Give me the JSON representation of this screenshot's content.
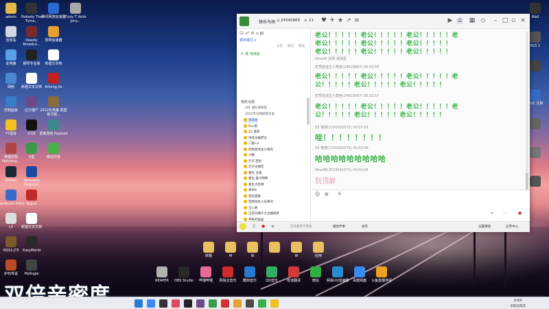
{
  "desktop": {
    "icons_left": [
      {
        "label": "admin",
        "color": "#e6b84a"
      },
      {
        "label": "回收站",
        "color": "#cfd8e3"
      },
      {
        "label": "此电脑",
        "color": "#5aa0e6"
      },
      {
        "label": "网络",
        "color": "#4a86d0"
      },
      {
        "label": "控制面板",
        "color": "#3a7cc9"
      },
      {
        "label": "YY语音",
        "color": "#f3c024"
      },
      {
        "label": "修魂苏明 Mahjong...",
        "color": "#b34444"
      },
      {
        "label": "Steam",
        "color": "#1b2838"
      },
      {
        "label": "Bandicam 64bit",
        "color": "#3b6bc9"
      },
      {
        "label": "LX",
        "color": "#dddddd"
      },
      {
        "label": "ISSS1.JTS",
        "color": "#7a5a2a"
      },
      {
        "label": "炉石传说",
        "color": "#b84d2a"
      }
    ],
    "icons_col2": [
      {
        "label": "Nobody The Turna...",
        "color": "#333333"
      },
      {
        "label": "Deadly Broadca...",
        "color": "#7a2a2a"
      },
      {
        "label": "钢琴专业版",
        "color": "#222222"
      },
      {
        "label": "新建文本文档",
        "color": "#ffffff"
      },
      {
        "label": "亿万僵尸",
        "color": "#6a4a8a"
      },
      {
        "label": "iCUE",
        "color": "#111111"
      },
      {
        "label": "X蓝",
        "color": "#3a9a4a"
      },
      {
        "label": "Samsung Magician",
        "color": "#1a4aa0"
      },
      {
        "label": "Rogue",
        "color": "#c02a2a"
      },
      {
        "label": "新建文本文档",
        "color": "#ffffff"
      },
      {
        "label": "EasyWorld",
        "color": "#2a2a2a"
      },
      {
        "label": "MyKugle",
        "color": "#444444"
      }
    ],
    "icons_col3": [
      {
        "label": "腾讯网游加速器",
        "color": "#2a6ad0"
      },
      {
        "label": "雷神加速器",
        "color": "#e8a030"
      },
      {
        "label": "新建文本档",
        "color": "#ffffff"
      },
      {
        "label": "Among Us",
        "color": "#c02020"
      },
      {
        "label": "2022年英雄 联盟 官方服...",
        "color": "#8a6a3a"
      },
      {
        "label": "雷索游戏 Payload",
        "color": "#3a8a8a"
      },
      {
        "label": "微信托管",
        "color": "#4ab04a"
      }
    ],
    "icons_col4": [
      {
        "label": "Tizzy T VaVa Jony...",
        "color": "#aaaaaa"
      }
    ],
    "icons_right": [
      {
        "label": "Wall",
        "color": "#333333"
      },
      {
        "label": "RLS 1",
        "color": "#555555"
      },
      {
        "label": "",
        "color": "#444444"
      },
      {
        "label": "DOC 文档",
        "color": "#3a6ac9"
      },
      {
        "label": "",
        "color": "#666666"
      },
      {
        "label": "",
        "color": "#777777"
      },
      {
        "label": "",
        "color": "#555555"
      }
    ],
    "icons_bottom": [
      {
        "label": "REAPER",
        "color": "#b0b0b0"
      },
      {
        "label": "OBS Studio",
        "color": "#2a2a2a"
      },
      {
        "label": "哔哩哔哩",
        "color": "#e86a9a"
      },
      {
        "label": "网易云音乐",
        "color": "#d02a2a"
      },
      {
        "label": "酷狗音乐",
        "color": "#2a7ad0"
      },
      {
        "label": "QQ音乐",
        "color": "#30b060"
      },
      {
        "label": "有道翻译",
        "color": "#d03a3a"
      },
      {
        "label": "微信",
        "color": "#30b040"
      },
      {
        "label": "网易UU加速器",
        "color": "#2a8ad0"
      },
      {
        "label": "百度网盘",
        "color": "#3a8af0"
      },
      {
        "label": "斗鱼直播伴侣",
        "color": "#f0a020"
      }
    ],
    "folders_row": [
      "拼题",
      "M",
      "W",
      "",
      "W",
      "应用"
    ]
  },
  "watermark": "双倍亲密度",
  "window": {
    "title": "快乐马场",
    "id": "24540869",
    "online": "21",
    "mode_label": "麦序模式 ▾",
    "tabs": [
      "公告",
      "留言",
      "成员"
    ],
    "host_line": "4. 嘶 落渐星",
    "channel_header": "快乐马场",
    "channel_items": [
      {
        "label": "20F 战队接机区"
      },
      {
        "label": "2022年马场默契大会"
      }
    ],
    "user_list": [
      "落渐星",
      "Kiss郎",
      "22 请请",
      "中等主编梦主",
      "二嫂+2",
      "优秀俗谣主小角色",
      "小鹏",
      "元子 西老",
      "元子主播无",
      "看生 玉菌",
      "看生 嘉冷网神",
      "看生大新佛",
      "郭中8",
      "谐生越春",
      "怒网淘生小乐碍对",
      "王心君",
      "王音同播千大主播榜并",
      "神奇的猫盒"
    ],
    "chat_lines": [
      "老公！！！！！老公！！！！！老公！！！！！老",
      "老公！！！！！老公！！！！！老公！！！！！",
      "老公！！！！！老公！！！！！老公！！！！！老",
      "公！！！！！老公！！！！！老公！！！！！",
      "老公！！！！！老公！！！！！老公！！！！！老",
      "公！！！！！老公！！！！！老公！！！！！"
    ],
    "meta_lines": [
      "Nine95 进场 落渐星",
      "优秀俗谣主小角色(24619897) 00:02:56",
      "优秀俗谣主小角色(24619897) 00:02:57",
      "S3 谨谨(2100182575) 00:03:03",
      "S3 谨谨(2100182575) 00:03:06",
      "Nine95(2533341071) 00:03:06"
    ],
    "short_msg_1": "哇！！！！！！！！",
    "short_msg_2": "哈哈哈哈哈哈哈哈哈",
    "faded_msg": "别顶屏",
    "input_count": "6",
    "bottom_bar": {
      "left_label": "空白麦序不需排",
      "mid_label": "播放伴奏",
      "right_label": "录音",
      "right_1": "设置播放",
      "right_2": "应用中心"
    }
  },
  "taskbar": {
    "time": "0:03",
    "date": "2022/5/2"
  }
}
